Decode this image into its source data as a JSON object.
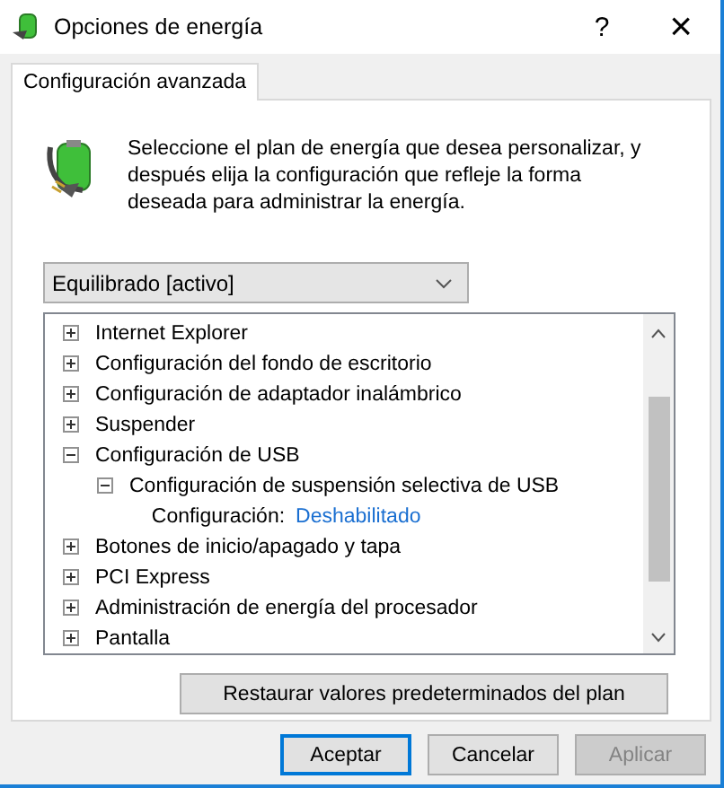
{
  "window": {
    "title": "Opciones de energía",
    "help": "?",
    "close": "×"
  },
  "tabs": [
    {
      "label": "Configuración avanzada",
      "selected": true
    }
  ],
  "description": "Seleccione el plan de energía que desea personalizar, y después elija la configuración que refleje la forma deseada para administrar la energía.",
  "plan_dropdown": {
    "value": "Equilibrado [activo]"
  },
  "tree": [
    {
      "label": "Internet Explorer",
      "expanded": false
    },
    {
      "label": "Configuración del fondo de escritorio",
      "expanded": false
    },
    {
      "label": "Configuración de adaptador inalámbrico",
      "expanded": false
    },
    {
      "label": "Suspender",
      "expanded": false
    },
    {
      "label": "Configuración de USB",
      "expanded": true,
      "children": [
        {
          "label": "Configuración de suspensión selectiva de USB",
          "expanded": true,
          "children": [
            {
              "kind": "setting",
              "label": "Configuración:",
              "value": "Deshabilitado"
            }
          ]
        }
      ]
    },
    {
      "label": "Botones de inicio/apagado y tapa",
      "expanded": false
    },
    {
      "label": "PCI Express",
      "expanded": false
    },
    {
      "label": "Administración de energía del procesador",
      "expanded": false
    },
    {
      "label": "Pantalla",
      "expanded": false
    }
  ],
  "restore_button": "Restaurar valores predeterminados del plan",
  "buttons": [
    {
      "label": "Aceptar",
      "kind": "default",
      "disabled": false
    },
    {
      "label": "Cancelar",
      "kind": "normal",
      "disabled": false
    },
    {
      "label": "Aplicar",
      "kind": "normal",
      "disabled": true
    }
  ]
}
